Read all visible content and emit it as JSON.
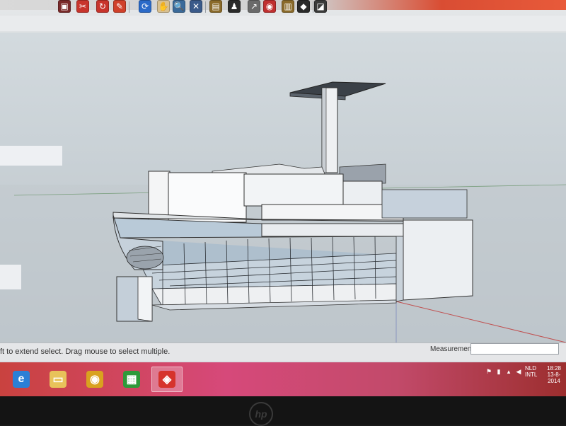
{
  "toolbar": {
    "icons": [
      {
        "name": "save-icon",
        "color": "#7a2a2a",
        "glyph": "▣"
      },
      {
        "name": "cut-icon",
        "color": "#c8342c",
        "glyph": "✂"
      },
      {
        "name": "redo-icon",
        "color": "#c8342c",
        "glyph": "↻"
      },
      {
        "name": "paint-icon",
        "color": "#d0402a",
        "glyph": "✎"
      },
      {
        "name": "orbit-icon",
        "color": "#2a6ac8",
        "glyph": "⟳"
      },
      {
        "name": "pan-hand-icon",
        "color": "#d8c090",
        "glyph": "✋"
      },
      {
        "name": "zoom-icon",
        "color": "#3a6a9a",
        "glyph": "🔍"
      },
      {
        "name": "zoom-extents-icon",
        "color": "#3a5a8a",
        "glyph": "✕"
      },
      {
        "name": "camera-icon",
        "color": "#8a6a2a",
        "glyph": "▤"
      },
      {
        "name": "walk-icon",
        "color": "#2a2a2a",
        "glyph": "♟"
      },
      {
        "name": "position-camera-icon",
        "color": "#6a6a6a",
        "glyph": "↗"
      },
      {
        "name": "lookaround-icon",
        "color": "#c03030",
        "glyph": "◉"
      },
      {
        "name": "section-plane-icon",
        "color": "#8a6a2a",
        "glyph": "▥"
      },
      {
        "name": "component-icon",
        "color": "#2a2a2a",
        "glyph": "◆"
      },
      {
        "name": "materials-icon",
        "color": "#3a3a3a",
        "glyph": "◪"
      }
    ]
  },
  "status": {
    "hint": "ft to extend select. Drag mouse to select multiple.",
    "measurements_label": "Measurements",
    "measurements_value": ""
  },
  "taskbar": {
    "apps": [
      {
        "name": "internet-explorer-icon",
        "glyph": "e",
        "color": "#2b7fd6"
      },
      {
        "name": "file-explorer-icon",
        "glyph": "▭",
        "color": "#e8c25a"
      },
      {
        "name": "chrome-icon",
        "glyph": "◉",
        "color": "#d9a21f"
      },
      {
        "name": "store-icon",
        "glyph": "▦",
        "color": "#2e9a3a"
      },
      {
        "name": "sketchup-icon",
        "glyph": "◈",
        "color": "#d6332c",
        "active": true
      }
    ],
    "language_top": "NLD",
    "language_bottom": "INTL",
    "time": "18:28",
    "date": "13-8-2014"
  }
}
